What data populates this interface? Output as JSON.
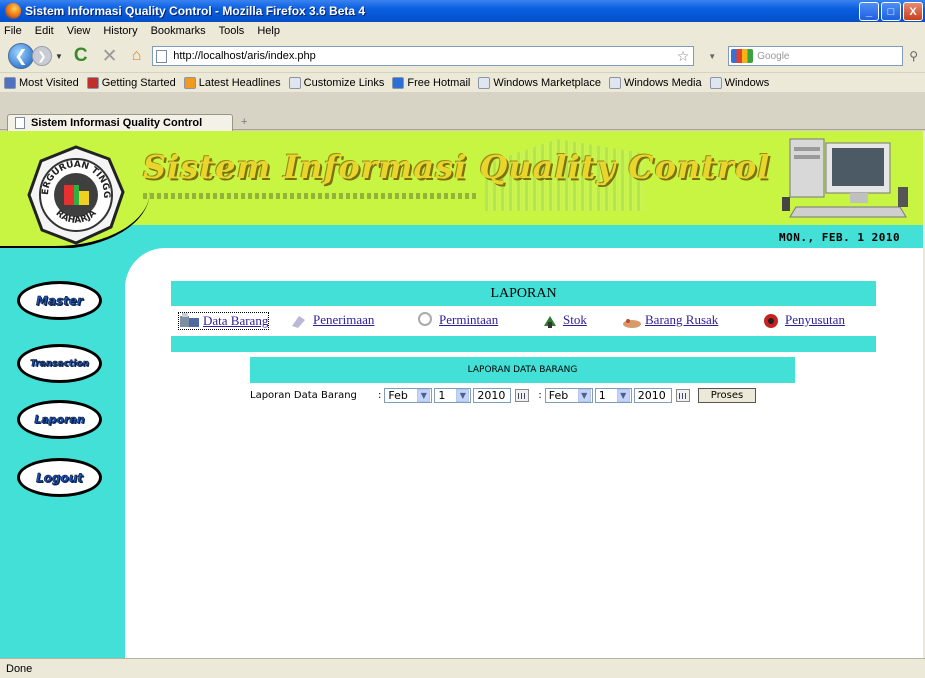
{
  "window": {
    "title": "Sistem Informasi Quality Control - Mozilla Firefox 3.6 Beta 4",
    "buttons": [
      "_",
      "□",
      "X"
    ]
  },
  "menu": [
    "File",
    "Edit",
    "View",
    "History",
    "Bookmarks",
    "Tools",
    "Help"
  ],
  "nav": {
    "url": "http://localhost/aris/index.php",
    "search_placeholder": "Google"
  },
  "bookmarks": [
    {
      "label": "Most Visited",
      "color": "#5070c0"
    },
    {
      "label": "Getting Started",
      "color": "#c0302a"
    },
    {
      "label": "Latest Headlines",
      "color": "#f19a1d"
    },
    {
      "label": "Customize Links",
      "color": "#e0e6f0"
    },
    {
      "label": "Free Hotmail",
      "color": "#2b6fd6"
    },
    {
      "label": "Windows Marketplace",
      "color": "#e0e6f0"
    },
    {
      "label": "Windows Media",
      "color": "#e0e6f0"
    },
    {
      "label": "Windows",
      "color": "#e0e6f0"
    }
  ],
  "tab": {
    "label": "Sistem Informasi Quality Control",
    "new_tab": "+"
  },
  "site": {
    "title": "Sistem Informasi Quality Control",
    "logo_top": "PERGURUAN TINGGI",
    "logo_bottom": "RAHARJA",
    "date": "MON., FEB. 1 2010"
  },
  "sidebar": [
    "Master",
    "Transaction",
    "Laporan",
    "Logout"
  ],
  "laporan": {
    "heading": "LAPORAN",
    "links": [
      "Data Barang",
      "Penerimaan",
      "Permintaan",
      "Stok",
      "Barang Rusak",
      "Penyusutan"
    ]
  },
  "report": {
    "heading": "LAPORAN DATA BARANG",
    "label": "Laporan Data Barang",
    "from": {
      "month": "Feb",
      "day": "1",
      "year": "2010"
    },
    "to": {
      "month": "Feb",
      "day": "1",
      "year": "2010"
    },
    "button": "Proses"
  },
  "status": "Done"
}
